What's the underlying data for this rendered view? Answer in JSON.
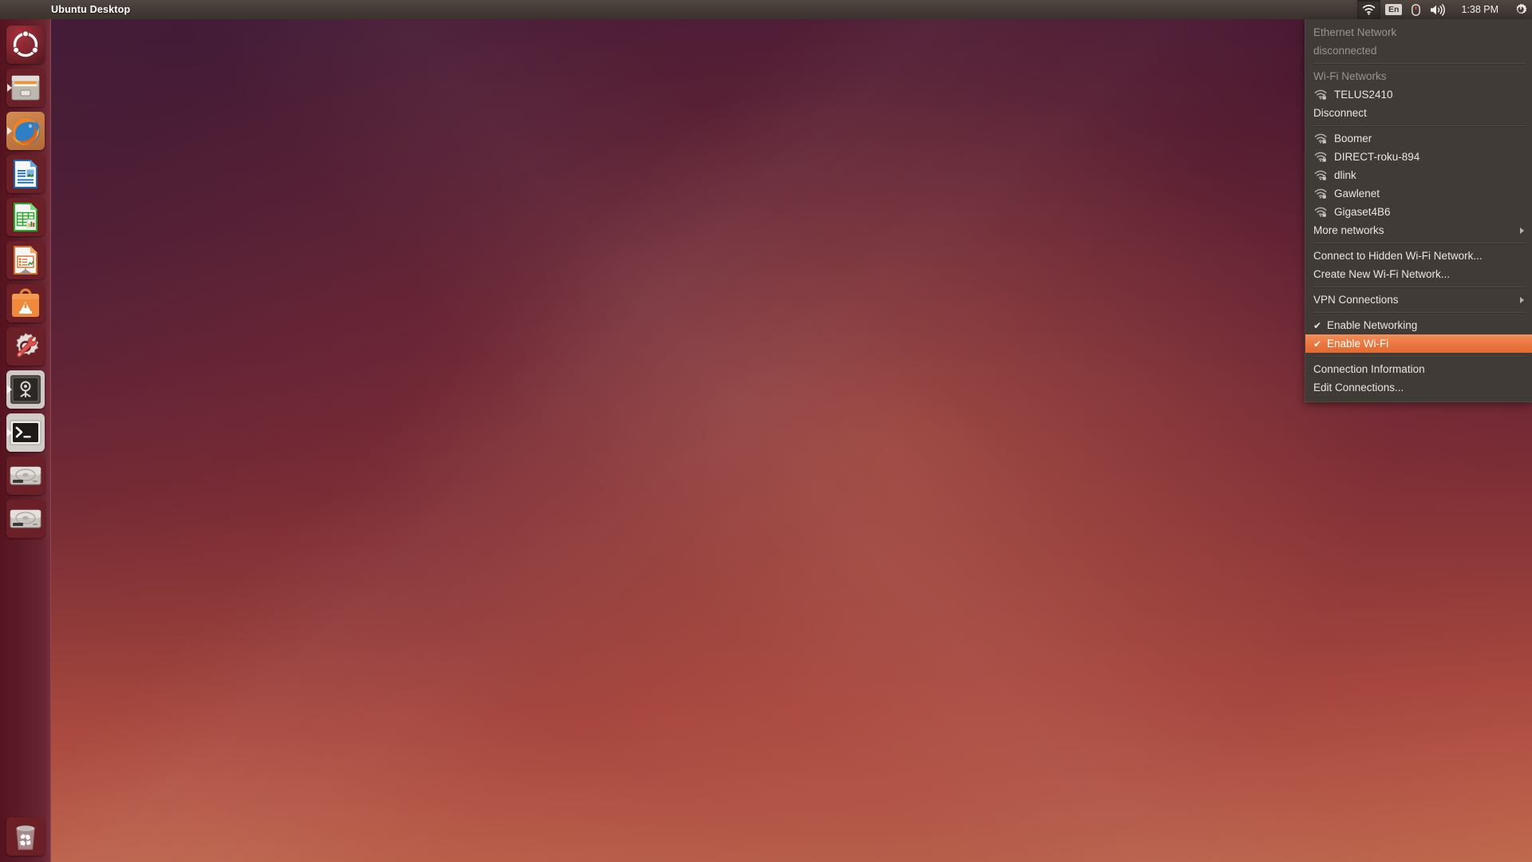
{
  "panel": {
    "title": "Ubuntu Desktop",
    "clock": "1:38 PM",
    "keyboard_layout": "En",
    "indicators": [
      {
        "name": "network-indicator",
        "icon": "wifi-icon",
        "active": true
      },
      {
        "name": "keyboard-indicator",
        "icon": "keyboard-icon",
        "label": "En"
      },
      {
        "name": "bluetooth-indicator",
        "icon": "bluetooth-mouse-icon"
      },
      {
        "name": "sound-indicator",
        "icon": "volume-icon"
      },
      {
        "name": "clock-indicator",
        "icon": "clock-icon",
        "label": "1:38 PM"
      },
      {
        "name": "session-indicator",
        "icon": "gear-power-icon"
      }
    ]
  },
  "launcher": {
    "items": [
      {
        "name": "dash-home",
        "icon": "ubuntu-logo-icon",
        "running": false
      },
      {
        "name": "files",
        "icon": "file-cabinet-icon",
        "running": true
      },
      {
        "name": "firefox",
        "icon": "firefox-icon",
        "running": true
      },
      {
        "name": "libreoffice-writer",
        "icon": "writer-document-icon",
        "running": false
      },
      {
        "name": "libreoffice-calc",
        "icon": "calc-spreadsheet-icon",
        "running": false
      },
      {
        "name": "libreoffice-impress",
        "icon": "impress-presentation-icon",
        "running": false
      },
      {
        "name": "ubuntu-software-center",
        "icon": "software-bag-icon",
        "running": false
      },
      {
        "name": "system-settings",
        "icon": "gear-wrench-icon",
        "running": false
      },
      {
        "name": "ubuntu-help",
        "icon": "safe-vault-icon",
        "running": true
      },
      {
        "name": "terminal",
        "icon": "terminal-icon",
        "running": true
      },
      {
        "name": "disk-volume-1",
        "icon": "hard-disk-icon",
        "running": false
      },
      {
        "name": "disk-volume-2",
        "icon": "hard-disk-icon",
        "running": false
      }
    ],
    "trash": {
      "name": "trash",
      "icon": "trash-bin-icon"
    }
  },
  "network_menu": {
    "ethernet_section": {
      "title": "Ethernet Network",
      "status": "disconnected"
    },
    "wifi_section_title": "Wi-Fi Networks",
    "active_network": {
      "ssid": "TELUS2410",
      "icon": "wifi-secured-icon",
      "disconnect_label": "Disconnect"
    },
    "available_networks": [
      {
        "ssid": "Boomer",
        "icon": "wifi-secured-icon"
      },
      {
        "ssid": "DIRECT-roku-894",
        "icon": "wifi-secured-icon"
      },
      {
        "ssid": "dlink",
        "icon": "wifi-secured-icon"
      },
      {
        "ssid": "Gawlenet",
        "icon": "wifi-secured-icon"
      },
      {
        "ssid": "Gigaset4B6",
        "icon": "wifi-secured-icon"
      }
    ],
    "more_networks_label": "More networks",
    "connect_hidden_label": "Connect to Hidden Wi-Fi Network...",
    "create_network_label": "Create New Wi-Fi Network...",
    "vpn_label": "VPN Connections",
    "enable_networking": {
      "label": "Enable Networking",
      "checked": true,
      "check_glyph": "✔"
    },
    "enable_wifi": {
      "label": "Enable Wi-Fi",
      "checked": true,
      "check_glyph": "✔",
      "highlighted": true
    },
    "connection_information_label": "Connection Information",
    "edit_connections_label": "Edit Connections...",
    "highlight_color": "#ea7840",
    "background_color": "#403b36"
  }
}
